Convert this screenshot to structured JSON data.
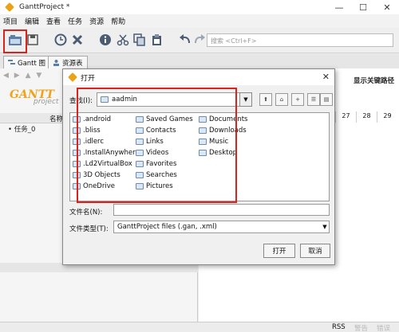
{
  "window": {
    "title": "GanttProject *",
    "minimize": "—",
    "maximize": "☐",
    "close": "✕"
  },
  "menu": [
    "项目",
    "编辑",
    "查看",
    "任务",
    "资源",
    "帮助"
  ],
  "toolbar": {
    "search_placeholder": "搜索 <Ctrl+F>"
  },
  "tabs": [
    "Gantt 图",
    "资源表"
  ],
  "gantt": {
    "logo": "GANTT",
    "logo_sub": "project",
    "column_name": "名称",
    "task": "任务_0",
    "critical_path": "显示关键路径",
    "days": [
      "27",
      "28",
      "29"
    ]
  },
  "status": {
    "rss": "RSS",
    "warnings": "警告",
    "errors": "错误"
  },
  "dialog": {
    "title": "打开",
    "lookin_label": "查找(I):",
    "lookin_value": "aadmin",
    "files_col1": [
      ".android",
      ".bliss",
      ".idlerc",
      ".InstallAnywhere",
      ".Ld2VirtualBox",
      "3D Objects",
      "OneDrive"
    ],
    "files_col2": [
      "Saved Games",
      "Contacts",
      "Links",
      "Videos",
      "Favorites",
      "Searches",
      "Pictures"
    ],
    "files_col3": [
      "Documents",
      "Downloads",
      "Music",
      "Desktop"
    ],
    "filename_label": "文件名(N):",
    "filename_value": "",
    "filetype_label": "文件类型(T):",
    "filetype_value": "GanttProject files (.gan, .xml)",
    "open_button": "打开",
    "cancel_button": "取消"
  },
  "colors": {
    "highlight": "#d9231c",
    "accent": "#f0a318",
    "folder_border": "#6a8caf"
  }
}
